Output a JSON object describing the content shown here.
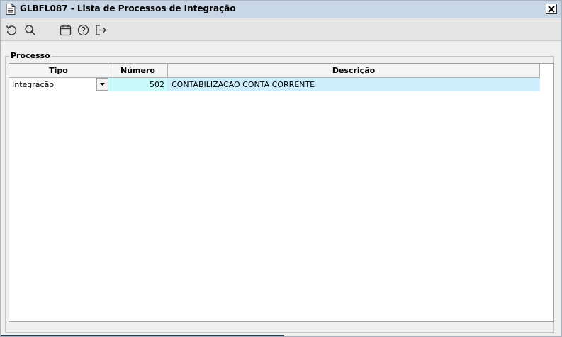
{
  "window": {
    "title": "GLBFL087 - Lista de Processos de Integração",
    "close_glyph": "✕"
  },
  "toolbar": {
    "buttons": [
      {
        "name": "refresh",
        "icon": "refresh-icon"
      },
      {
        "name": "search",
        "icon": "search-icon"
      },
      {
        "name": "calendar",
        "icon": "calendar-icon"
      },
      {
        "name": "help",
        "icon": "help-icon"
      },
      {
        "name": "exit",
        "icon": "exit-icon"
      }
    ]
  },
  "group": {
    "legend": "Processo"
  },
  "grid": {
    "columns": [
      "Tipo",
      "Número",
      "Descrição"
    ],
    "rows": [
      {
        "tipo": "Integração",
        "numero": "502",
        "descricao": "CONTABILIZACAO CONTA CORRENTE"
      }
    ]
  },
  "colors": {
    "titlebar": "#c8d6e5",
    "row_highlight": "#cdeefd",
    "numero_cell": "#c9fbfb"
  }
}
